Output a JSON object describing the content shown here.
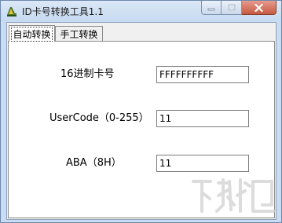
{
  "window": {
    "title": "ID卡号转换工具1.1"
  },
  "tabs": [
    {
      "label": "自动转换"
    },
    {
      "label": "手工转换"
    }
  ],
  "form": {
    "hex_label": "16进制卡号",
    "hex_value": "FFFFFFFFFF",
    "usercode_label": "UserCode（0-255）",
    "usercode_value": "11",
    "aba_label": "ABA（8H）",
    "aba_value": "11"
  },
  "icons": {
    "app": "app-icon",
    "minimize": "minimize-icon",
    "maximize": "maximize-icon",
    "close": "close-icon"
  },
  "colors": {
    "titlebar": "#c9dcf1",
    "close_button": "#c65a42"
  }
}
